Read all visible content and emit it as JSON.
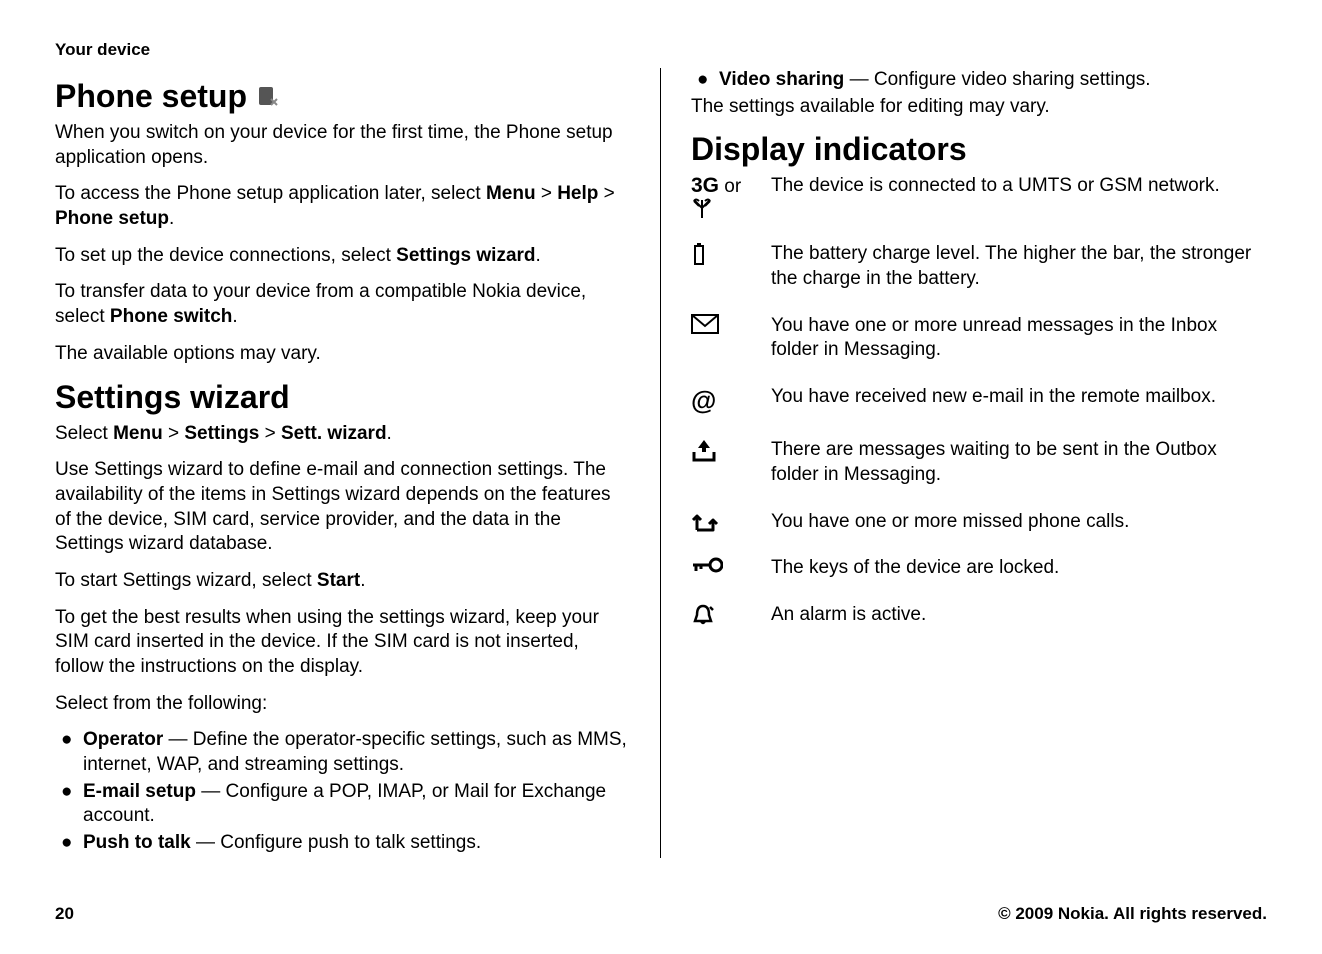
{
  "header": "Your device",
  "footer": {
    "page": "20",
    "copyright": "© 2009 Nokia. All rights reserved."
  },
  "left": {
    "h1_phone_setup": "Phone setup",
    "p1a": "When you switch on your device for the first time, the Phone setup application opens.",
    "p2a": "To access the Phone setup application later, select ",
    "p2b": "Menu",
    "p2c": " > ",
    "p2d": "Help",
    "p2e": " > ",
    "p2f": "Phone setup",
    "p2g": ".",
    "p3a": "To set up the device connections, select ",
    "p3b": "Settings wizard",
    "p3c": ".",
    "p4a": "To transfer data to your device from a compatible Nokia device, select ",
    "p4b": "Phone switch",
    "p4c": ".",
    "p5": "The available options may vary.",
    "h1_settings": "Settings wizard",
    "s1a": "Select ",
    "s1b": "Menu",
    "s1c": " > ",
    "s1d": "Settings",
    "s1e": " > ",
    "s1f": "Sett. wizard",
    "s1g": ".",
    "s2": "Use Settings wizard to define e-mail and connection settings. The availability of the items in Settings wizard depends on the features of the device, SIM card, service provider, and the data in the Settings wizard database.",
    "s3a": "To start Settings wizard, select ",
    "s3b": "Start",
    "s3c": ".",
    "s4": "To get the best results when using the settings wizard, keep your SIM card inserted in the device. If the SIM card is not inserted, follow the instructions on the display.",
    "s5": "Select from the following:",
    "li1a": "Operator",
    "li1b": "  — Define the operator-specific settings, such as MMS, internet, WAP, and streaming settings.",
    "li2a": "E-mail setup",
    "li2b": "  — Configure a POP, IMAP, or Mail for Exchange account.",
    "li3a": "Push to talk",
    "li3b": "  — Configure push to talk settings."
  },
  "right": {
    "li4a": "Video sharing",
    "li4b": "  — Configure video sharing settings.",
    "r1": "The settings available for editing may vary.",
    "h1_display": "Display indicators",
    "ind1_pre": "3G",
    "ind1_or": " or",
    "ind1": "The device is connected to a UMTS or GSM network.",
    "ind2": "The battery charge level. The higher the bar, the stronger the charge in the battery.",
    "ind3": "You have one or more unread messages in the Inbox folder in Messaging.",
    "ind4": "You have received new e-mail in the remote mailbox.",
    "ind5": "There are messages waiting to be sent in the Outbox folder in Messaging.",
    "ind6": "You have one or more missed phone calls.",
    "ind7": "The keys of the device are locked.",
    "ind8": "An alarm is active."
  }
}
